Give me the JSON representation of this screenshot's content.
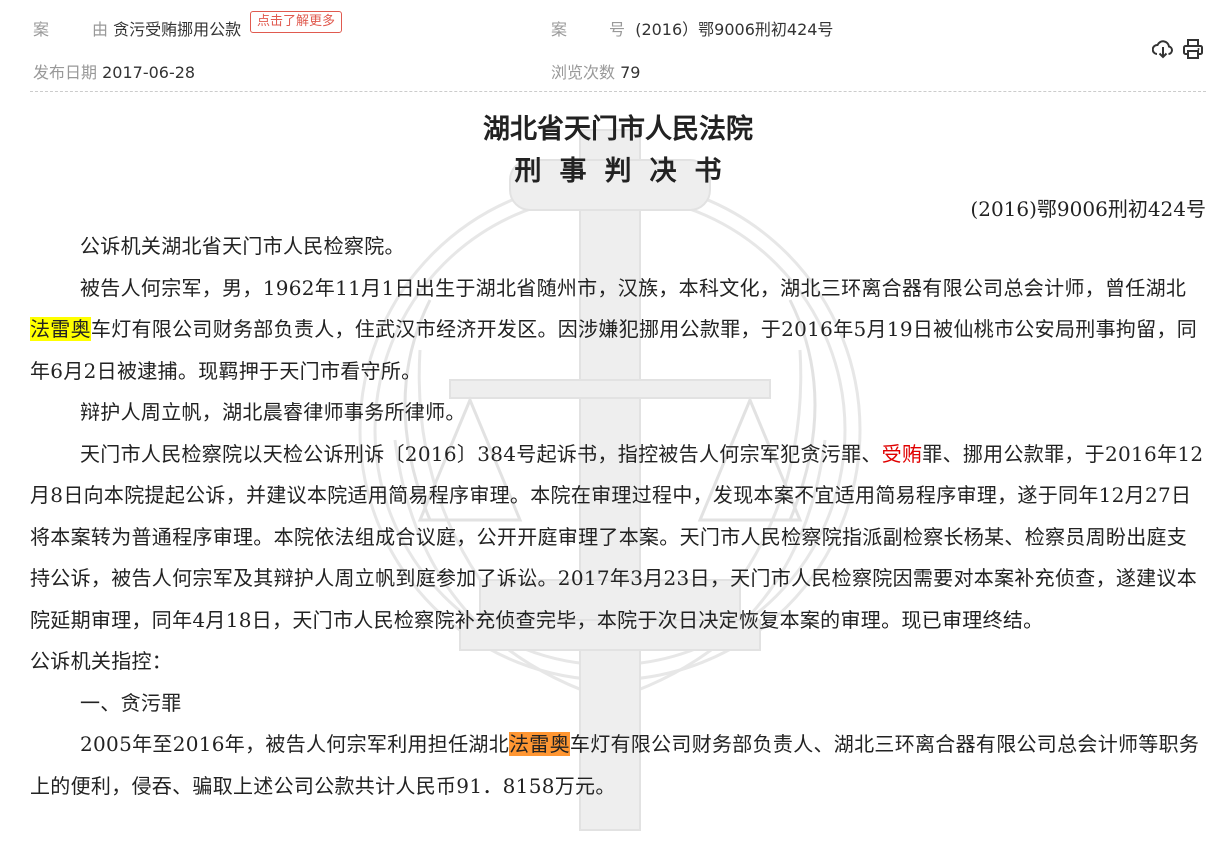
{
  "header": {
    "case_cause_label_a": "案",
    "case_cause_label_b": "由",
    "case_cause_value": "贪污受贿挪用公款",
    "more_button": "点击了解更多",
    "case_no_label_a": "案",
    "case_no_label_b": "号",
    "case_no_value": "(2016）鄂9006刑初424号",
    "pub_date_label": "发布日期",
    "pub_date_value": "2017-06-28",
    "views_label": "浏览次数",
    "views_value": "79",
    "icons": [
      "download-icon",
      "print-icon"
    ]
  },
  "document": {
    "court": "湖北省天门市人民法院",
    "doc_type": "刑事判决书",
    "doc_no": "(2016)鄂9006刑初424号",
    "p1": "公诉机关湖北省天门市人民检察院。",
    "p2_a": "被告人何宗军，男，1962年11月1日出生于湖北省随州市，汉族，本科文化，湖北三环离合器有限公司总会计师，曾任湖北",
    "p2_hl": "法雷奥",
    "p2_b": "车灯有限公司财务部负责人，住武汉市经济开发区。因涉嫌犯挪用公款罪，于2016年5月19日被仙桃市公安局刑事拘留，同年6月2日被逮捕。现羁押于天门市看守所。",
    "p3": "辩护人周立帆，湖北晨睿律师事务所律师。",
    "p4_a": "天门市人民检察院以天检公诉刑诉〔2016〕384号起诉书，指控被告人何宗军犯贪污罪、",
    "p4_red": "受贿",
    "p4_b": "罪、挪用公款罪，于2016年12月8日向本院提起公诉，并建议本院适用简易程序审理。本院在审理过程中，发现本案不宜适用简易程序审理，遂于同年12月27日将本案转为普通程序审理。本院依法组成合议庭，公开开庭审理了本案。天门市人民检察院指派副检察长杨某、检察员周盼出庭支持公诉，被告人何宗军及其辩护人周立帆到庭参加了诉讼。2017年3月23日，天门市人民检察院因需要对本案补充侦查，遂建议本院延期审理，同年4月18日，天门市人民检察院补充侦查完毕，本院于次日决定恢复本案的审理。现已审理终结。",
    "p5": "公诉机关指控：",
    "p6": "一、贪污罪",
    "p7_a": "2005年至2016年，被告人何宗军利用担任湖北",
    "p7_hl": "法雷奥",
    "p7_b": "车灯有限公司财务部负责人、湖北三环离合器有限公司总会计师等职务上的便利，侵吞、骗取上述公司公款共计人民币91．8158万元。"
  },
  "colors": {
    "highlight_yellow": "#ffff00",
    "highlight_orange": "#ff9632",
    "keyword_red": "#e00000",
    "button_red": "#e05a4f"
  }
}
